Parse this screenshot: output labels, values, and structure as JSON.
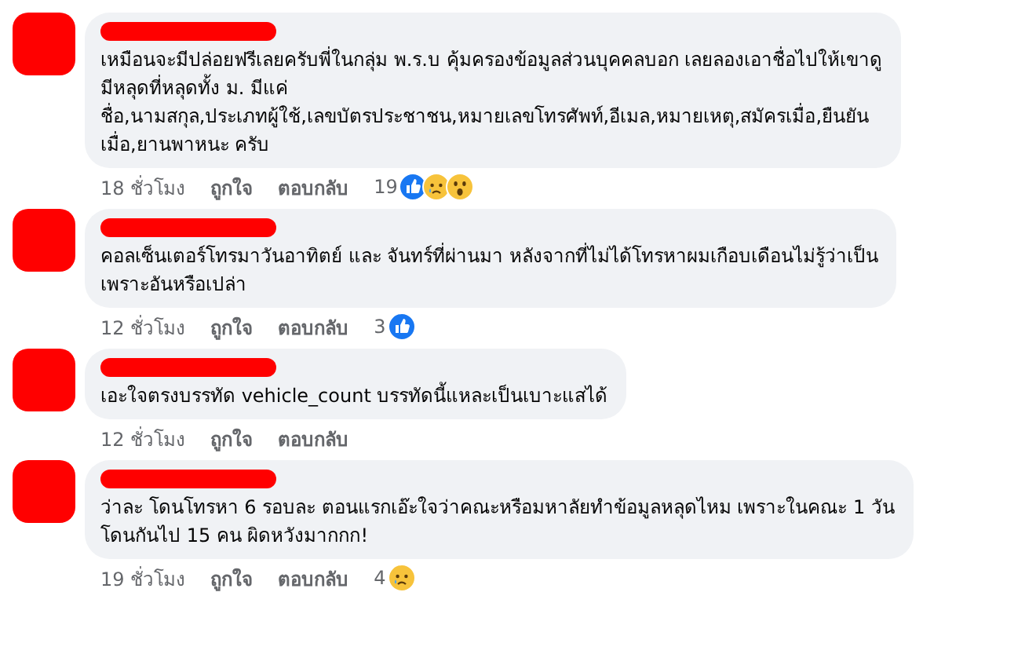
{
  "comments": [
    {
      "lines": [
        "เหมือนจะมีปล่อยฟรีเลยครับพี่ในกลุ่ม พ.ร.บ คุ้มครองข้อมูลส่วนบุคคลบอก เลยลองเอาชื่อไปให้เขาดู",
        "มีหลุดที่หลุดทั้ง ม. มีแค่",
        "ชื่อ,นามสกุล,ประเภทผู้ใช้,เลขบัตรประชาชน,หมายเลขโทรศัพท์,อีเมล,หมายเหตุ,สมัครเมื่อ,ยืนยัน",
        "เมื่อ,ยานพาหนะ ครับ"
      ],
      "time": "18 ชั่วโมง",
      "like": "ถูกใจ",
      "reply": "ตอบกลับ",
      "reaction_count": "19",
      "reactions": [
        {
          "kind": "like"
        },
        {
          "kind": "sad"
        },
        {
          "kind": "wow"
        }
      ]
    },
    {
      "lines": [
        "คอลเซ็นเตอร์โทรมาวันอาทิตย์ และ จันทร์ที่ผ่านมา หลังจากที่ไม่ได้โทรหาผมเกือบเดือนไม่รู้ว่าเป็น",
        "เพราะอันหรือเปล่า"
      ],
      "time": "12 ชั่วโมง",
      "like": "ถูกใจ",
      "reply": "ตอบกลับ",
      "reaction_count": "3",
      "reactions": [
        {
          "kind": "like"
        }
      ]
    },
    {
      "lines": [
        "เอะใจตรงบรรทัด vehicle_count บรรทัดนี้แหละเป็นเบาะแสได้"
      ],
      "time": "12 ชั่วโมง",
      "like": "ถูกใจ",
      "reply": "ตอบกลับ"
    },
    {
      "lines": [
        "ว่าละ โดนโทรหา 6 รอบละ ตอนแรกเอ๊ะใจว่าคณะหรือมหาลัยทำข้อมูลหลุดไหม เพราะในคณะ 1 วัน",
        "โดนกันไป 15 คน ผิดหวังมากกก!"
      ],
      "time": "19 ชั่วโมง",
      "like": "ถูกใจ",
      "reply": "ตอบกลับ",
      "reaction_count": "4",
      "reactions": [
        {
          "kind": "sad"
        }
      ]
    }
  ]
}
